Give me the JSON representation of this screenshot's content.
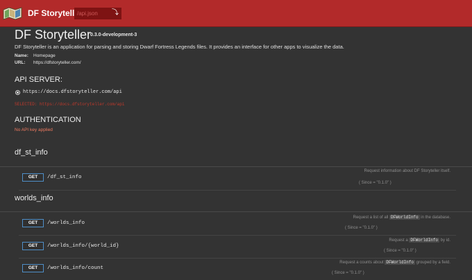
{
  "topbar": {
    "app_name": "DF Storyteller",
    "search_placeholder": "/api.json",
    "logo_icon": "map-logo-icon",
    "submit_icon": "enter-icon",
    "bar_color": "#b22a2a"
  },
  "info": {
    "title": "DF Storyteller",
    "version": "0.3.0-development-3",
    "description": "DF Storyteller is an application for parsing and storing Dwarf Fortress Legends files. It provides an interface for other apps to visualize the data.",
    "name_label": "Name:",
    "name_value": "Homepage",
    "url_label": "URL:",
    "url_value": "https://dfstoryteller.com/"
  },
  "api_server": {
    "heading": "API SERVER:",
    "option": "https://docs.dfstoryteller.com/api",
    "selected_text": "SELECTED: https://docs.dfstoryteller.com/api"
  },
  "authentication": {
    "heading": "AUTHENTICATION",
    "message": "No API key applied"
  },
  "tags": [
    {
      "name": "df_st_info",
      "operations": [
        {
          "method": "GET",
          "path": "/df_st_info",
          "desc_before": "Request information about DF Storyteller itself.",
          "desc_code": "",
          "desc_after": "",
          "since": "( Since = \"0.1.0\" )"
        }
      ]
    },
    {
      "name": "worlds_info",
      "operations": [
        {
          "method": "GET",
          "path": "/worlds_info",
          "desc_before": "Request a list of all",
          "desc_code": "DFWorldInfo",
          "desc_after": "in the database.",
          "since": "( Since = \"0.1.0\" )"
        },
        {
          "method": "GET",
          "path": "/worlds_info/{world_id}",
          "desc_before": "Request a",
          "desc_code": "DFWorldInfo",
          "desc_after": "by id.",
          "since": "( Since = \"0.1.0\" )"
        },
        {
          "method": "GET",
          "path": "/worlds_info/count",
          "desc_before": "Request a counts about",
          "desc_code": "DFWorldInfo",
          "desc_after": "grouped by a field.",
          "since": "( Since = \"0.1.0\" )"
        }
      ]
    }
  ],
  "colors": {
    "background": "#333333",
    "get_border": "#4f8fc8",
    "selected_text": "#c0392b",
    "auth_message": "#f07a60"
  }
}
